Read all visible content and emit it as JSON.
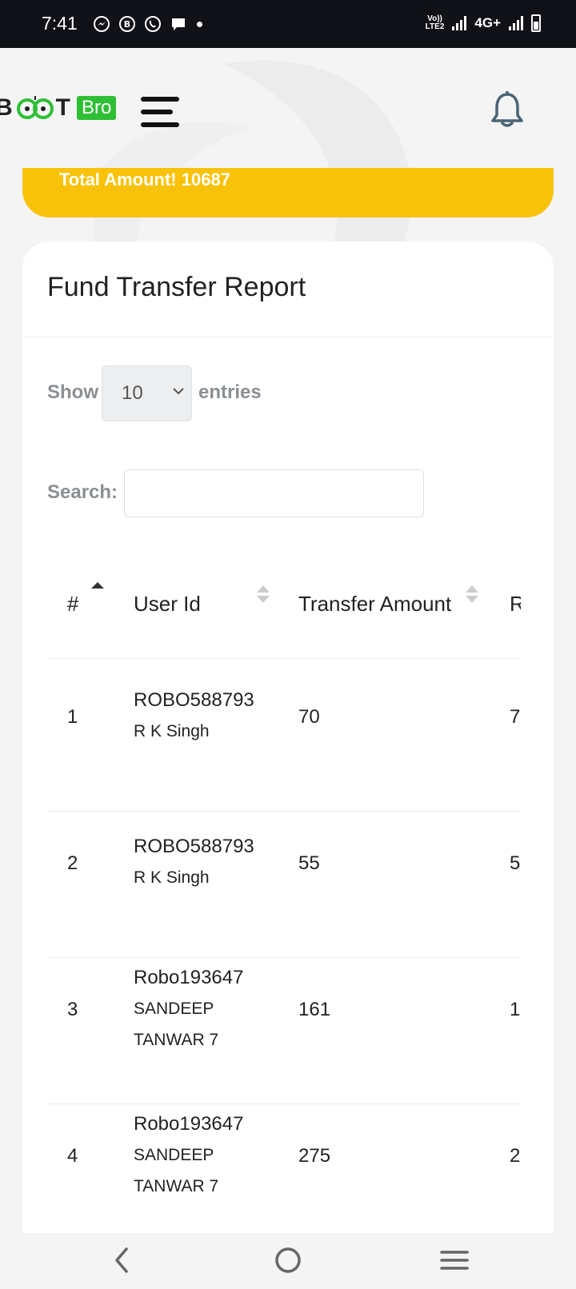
{
  "status_bar": {
    "time": "7:41",
    "lte_line1": "Vo))",
    "lte_line2": "LTE2",
    "network": "4G+",
    "icons": [
      "messenger-icon",
      "business-icon",
      "whatsapp-icon",
      "chat-icon"
    ]
  },
  "header": {
    "logo_text_left": "B",
    "logo_text_right": "T",
    "logo_badge": "Bro",
    "icons": [
      "menu-icon",
      "bell-icon"
    ]
  },
  "banner": {
    "label": "Total Amount! 10687"
  },
  "report": {
    "title": "Fund Transfer Report",
    "show_label": "Show",
    "entries_label": "entries",
    "page_length": "10",
    "search_label": "Search:",
    "search_value": "",
    "columns": [
      "#",
      "User Id",
      "Transfer Amount",
      "R"
    ],
    "rows": [
      {
        "num": "1",
        "user_id": "ROBO588793",
        "name_lines": [
          "R K Singh"
        ],
        "amount": "70",
        "next": "7"
      },
      {
        "num": "2",
        "user_id": "ROBO588793",
        "name_lines": [
          "R K Singh"
        ],
        "amount": "55",
        "next": "5"
      },
      {
        "num": "3",
        "user_id": "Robo193647",
        "name_lines": [
          "SANDEEP",
          "TANWAR 7"
        ],
        "amount": "161",
        "next": "1"
      },
      {
        "num": "4",
        "user_id": "Robo193647",
        "name_lines": [
          "SANDEEP",
          "TANWAR 7"
        ],
        "amount": "275",
        "next": "2"
      }
    ]
  },
  "colors": {
    "banner": "#f9c20a",
    "logo_green": "#2fbf35",
    "bell": "#4a6474"
  }
}
